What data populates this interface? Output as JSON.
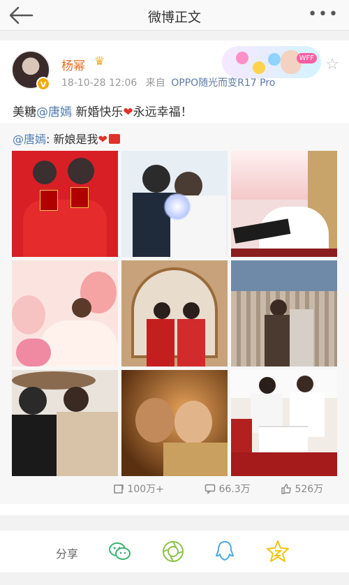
{
  "header": {
    "title": "微博正文"
  },
  "post": {
    "username": "杨幂",
    "time": "18-10-28 12:06",
    "source_prefix": "来自",
    "source": "OPPO随光而变R17 Pro",
    "text_part1": "美糖",
    "mention": "@唐嫣",
    "text_part2": " 新婚快乐",
    "text_part3": "永远幸福！",
    "decor_tag": "WFF"
  },
  "repost": {
    "mention": "@唐嫣",
    "text": ": 新娘是我"
  },
  "stats": {
    "reposts": "100万+",
    "comments": "66.3万",
    "likes": "526万"
  },
  "share": {
    "label": "分享"
  },
  "colors": {
    "username": "#e86b1f",
    "mention": "#4f7cb0",
    "heart": "#e0322a",
    "wechat": "#3cb371",
    "moments": "#8bc34a",
    "qq": "#4aa8e0",
    "qzone": "#f4c20d"
  }
}
